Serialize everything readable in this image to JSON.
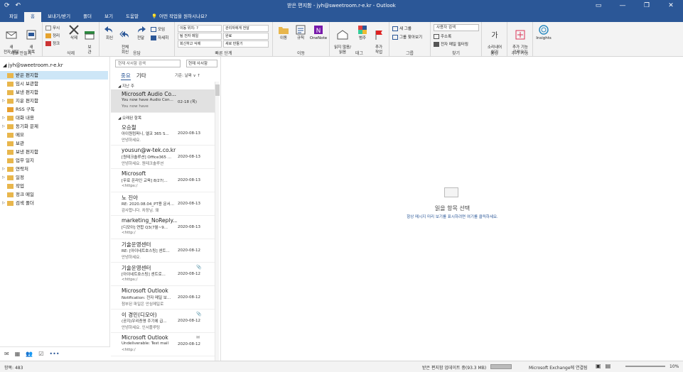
{
  "titlebar": {
    "title": "받은 편지함 - jyh@sweetroom.r-e.kr - Outlook",
    "qat": [
      "⟳",
      "↶"
    ],
    "winctl": [
      "▭",
      "—",
      "❐",
      "✕"
    ]
  },
  "tabs": [
    "파일",
    "홈",
    "보내기/받기",
    "폴더",
    "보기",
    "도움말"
  ],
  "tell_me": "어떤 작업을 원하시나요?",
  "ribbon": {
    "new": {
      "new_email": "새\n전자 메일",
      "new_items": "새\n항목",
      "label": "새로 만들기"
    },
    "delete": {
      "ignore": "무시",
      "cleanup": "정리",
      "junk": "정크",
      "delete": "삭제",
      "archive": "보\n관",
      "label": "삭제"
    },
    "respond": {
      "reply": "회신",
      "reply_all": "전체\n회신",
      "forward": "전달",
      "meeting": "모임",
      "more": "자세히",
      "label": "응답"
    },
    "quicksteps": {
      "items": [
        "이동 위치: ?",
        "관리자에게 전달",
        "팀 전자 메일",
        "완료",
        "회신하고 삭제",
        "새로 만들기"
      ],
      "label": "빠른 단계"
    },
    "move": {
      "move": "이동",
      "rules": "규칙",
      "onenote": "OneNote",
      "label": "이동"
    },
    "tags": {
      "unread": "읽지 않음/\n읽음",
      "categorize": "범주",
      "followup": "추가\n작업",
      "label": "태그"
    },
    "groups": {
      "new_group": "새 그룹",
      "browse": "그룹 찾아보기",
      "label": "그룹"
    },
    "find": {
      "search_people": "사용자 검색",
      "address_book": "주소록",
      "filter": "전자 메일 필터링",
      "label": "찾기"
    },
    "speech": {
      "read_aloud": "소리내어\n읽기",
      "label": "음성"
    },
    "addins": {
      "get_addins": "추가 기능\n가져오기",
      "label": "추가 기능"
    },
    "insights": {
      "insights": "Insights"
    }
  },
  "nav": {
    "account": "jyh@sweetroom.r-e.kr",
    "folders": [
      {
        "label": "받은 편지함",
        "selected": true,
        "arrow": ""
      },
      {
        "label": "임시 보관함",
        "arrow": ""
      },
      {
        "label": "보낸 편지함",
        "arrow": ""
      },
      {
        "label": "지운 편지함",
        "arrow": "▷"
      },
      {
        "label": "RSS 구독",
        "arrow": ""
      },
      {
        "label": "대화 내용",
        "arrow": "▷"
      },
      {
        "label": "동기화 문제",
        "arrow": "▷"
      },
      {
        "label": "메모",
        "arrow": ""
      },
      {
        "label": "보관",
        "arrow": ""
      },
      {
        "label": "보낸 편지함",
        "arrow": ""
      },
      {
        "label": "업무 일지",
        "arrow": ""
      },
      {
        "label": "연락처",
        "arrow": "▷"
      },
      {
        "label": "일정",
        "arrow": "▷"
      },
      {
        "label": "작업",
        "arrow": ""
      },
      {
        "label": "정크 메일",
        "arrow": ""
      },
      {
        "label": "검색 폴더",
        "arrow": "▷"
      }
    ],
    "bottom_icons": [
      "✉",
      "▦",
      "👥",
      "☑",
      "•••"
    ]
  },
  "list": {
    "search_placeholder": "현재 사서함 검색",
    "scope": "현재 사서함",
    "tabs": [
      "중요",
      "기타"
    ],
    "sort": "기준: 날짜 ∨  ↑",
    "groups": [
      "지난 주",
      "오래된 항목"
    ],
    "mails": [
      {
        "from": "Microsoft Audio Co...",
        "subject": "You now have Audio Con...",
        "preview": "You now have",
        "date": "02-18 (목)",
        "attach": ""
      },
      {
        "from": "오승철",
        "subject": "아이원컴퍼니, 엘코 365 S...",
        "preview": "안녕하세요.",
        "date": "2020-08-13",
        "attach": ""
      },
      {
        "from": "yousun@w-tek.co.kr",
        "subject": "[원테크솔루션] Office365 ...",
        "preview": "안녕하세요. 원테크솔루션",
        "date": "2020-08-13",
        "attach": ""
      },
      {
        "from": "Microsoft",
        "subject": "[무료 온라인 교육] 8/27(...",
        "preview": "<https:/",
        "date": "2020-08-13",
        "attach": ""
      },
      {
        "from": "노 진아",
        "subject": "RE: 2020.08.04_PT용 문서...",
        "preview": "감사합니다. 차장님.  돼",
        "date": "2020-08-13",
        "attach": ""
      },
      {
        "from": "marketing_NoReply...",
        "subject": "[디모아] 연합 Q3(7월~9...",
        "preview": "<http:/",
        "date": "2020-08-13",
        "attach": ""
      },
      {
        "from": "기술운영센터",
        "subject": "RE: [아이네트호스팅] 센트...",
        "preview": "안녕하세요.",
        "date": "2020-08-12",
        "attach": ""
      },
      {
        "from": "기술운영센터",
        "subject": "[아이네트호스팅] 센트로...",
        "preview": "<https:/",
        "date": "2020-08-12",
        "attach": "📎"
      },
      {
        "from": "Microsoft Outlook",
        "subject": "Notification: 전자 메일 보...",
        "preview": "첨부된 파일은 안심메일로",
        "date": "2020-08-12",
        "attach": ""
      },
      {
        "from": "이 경민(디모아)",
        "subject": "(공지)우리증명 주기에 급...",
        "preview": "안녕하세요.  인서플루팅",
        "date": "2020-08-12",
        "attach": "📎"
      },
      {
        "from": "Microsoft Outlook",
        "subject": "Undeliverable: Test mail",
        "preview": "<http:/",
        "date": "2020-08-12",
        "attach": "✉"
      }
    ]
  },
  "reading": {
    "title": "읽을 항목 선택",
    "subtitle": "항상 메시지 미리 보기를 표시하려면 여기를 클릭하세요."
  },
  "status": {
    "items": "항목: 483",
    "sync": "받은 편지함 업데이트 중(93.3 MB)",
    "connection": "Microsoft Exchange에 연결됨",
    "zoom": "10%"
  }
}
